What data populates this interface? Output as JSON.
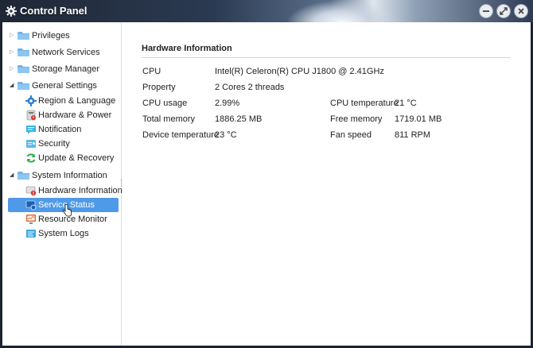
{
  "window": {
    "title": "Control Panel"
  },
  "sidebar": {
    "groups": [
      {
        "label": "Privileges"
      },
      {
        "label": "Network Services"
      },
      {
        "label": "Storage Manager"
      },
      {
        "label": "General Settings"
      },
      {
        "label": "System Information"
      }
    ],
    "general_settings_items": [
      {
        "label": "Region & Language"
      },
      {
        "label": "Hardware & Power"
      },
      {
        "label": "Notification"
      },
      {
        "label": "Security"
      },
      {
        "label": "Update & Recovery"
      }
    ],
    "system_information_items": [
      {
        "label": "Hardware Information"
      },
      {
        "label": "Service Status"
      },
      {
        "label": "Resource Monitor"
      },
      {
        "label": "System Logs"
      }
    ]
  },
  "main": {
    "section_title": "Hardware Information",
    "rows": [
      {
        "label": "CPU",
        "value": "Intel(R) Celeron(R) CPU J1800 @ 2.41GHz"
      },
      {
        "label": "Property",
        "value": "2 Cores 2 threads"
      },
      {
        "label": "CPU usage",
        "value": "2.99%"
      },
      {
        "label": "Total memory",
        "value": "1886.25 MB"
      },
      {
        "label": "Device temperature",
        "value": "23 °C"
      }
    ],
    "right_rows": [
      {
        "label": "CPU temperature",
        "value": "21 °C"
      },
      {
        "label": "Free memory",
        "value": "1719.01 MB"
      },
      {
        "label": "Fan speed",
        "value": "811 RPM"
      }
    ]
  },
  "colors": {
    "selected_bg": "#4f9ae8",
    "folder": "#6fb3ea",
    "titlebar": "#1f2735"
  }
}
